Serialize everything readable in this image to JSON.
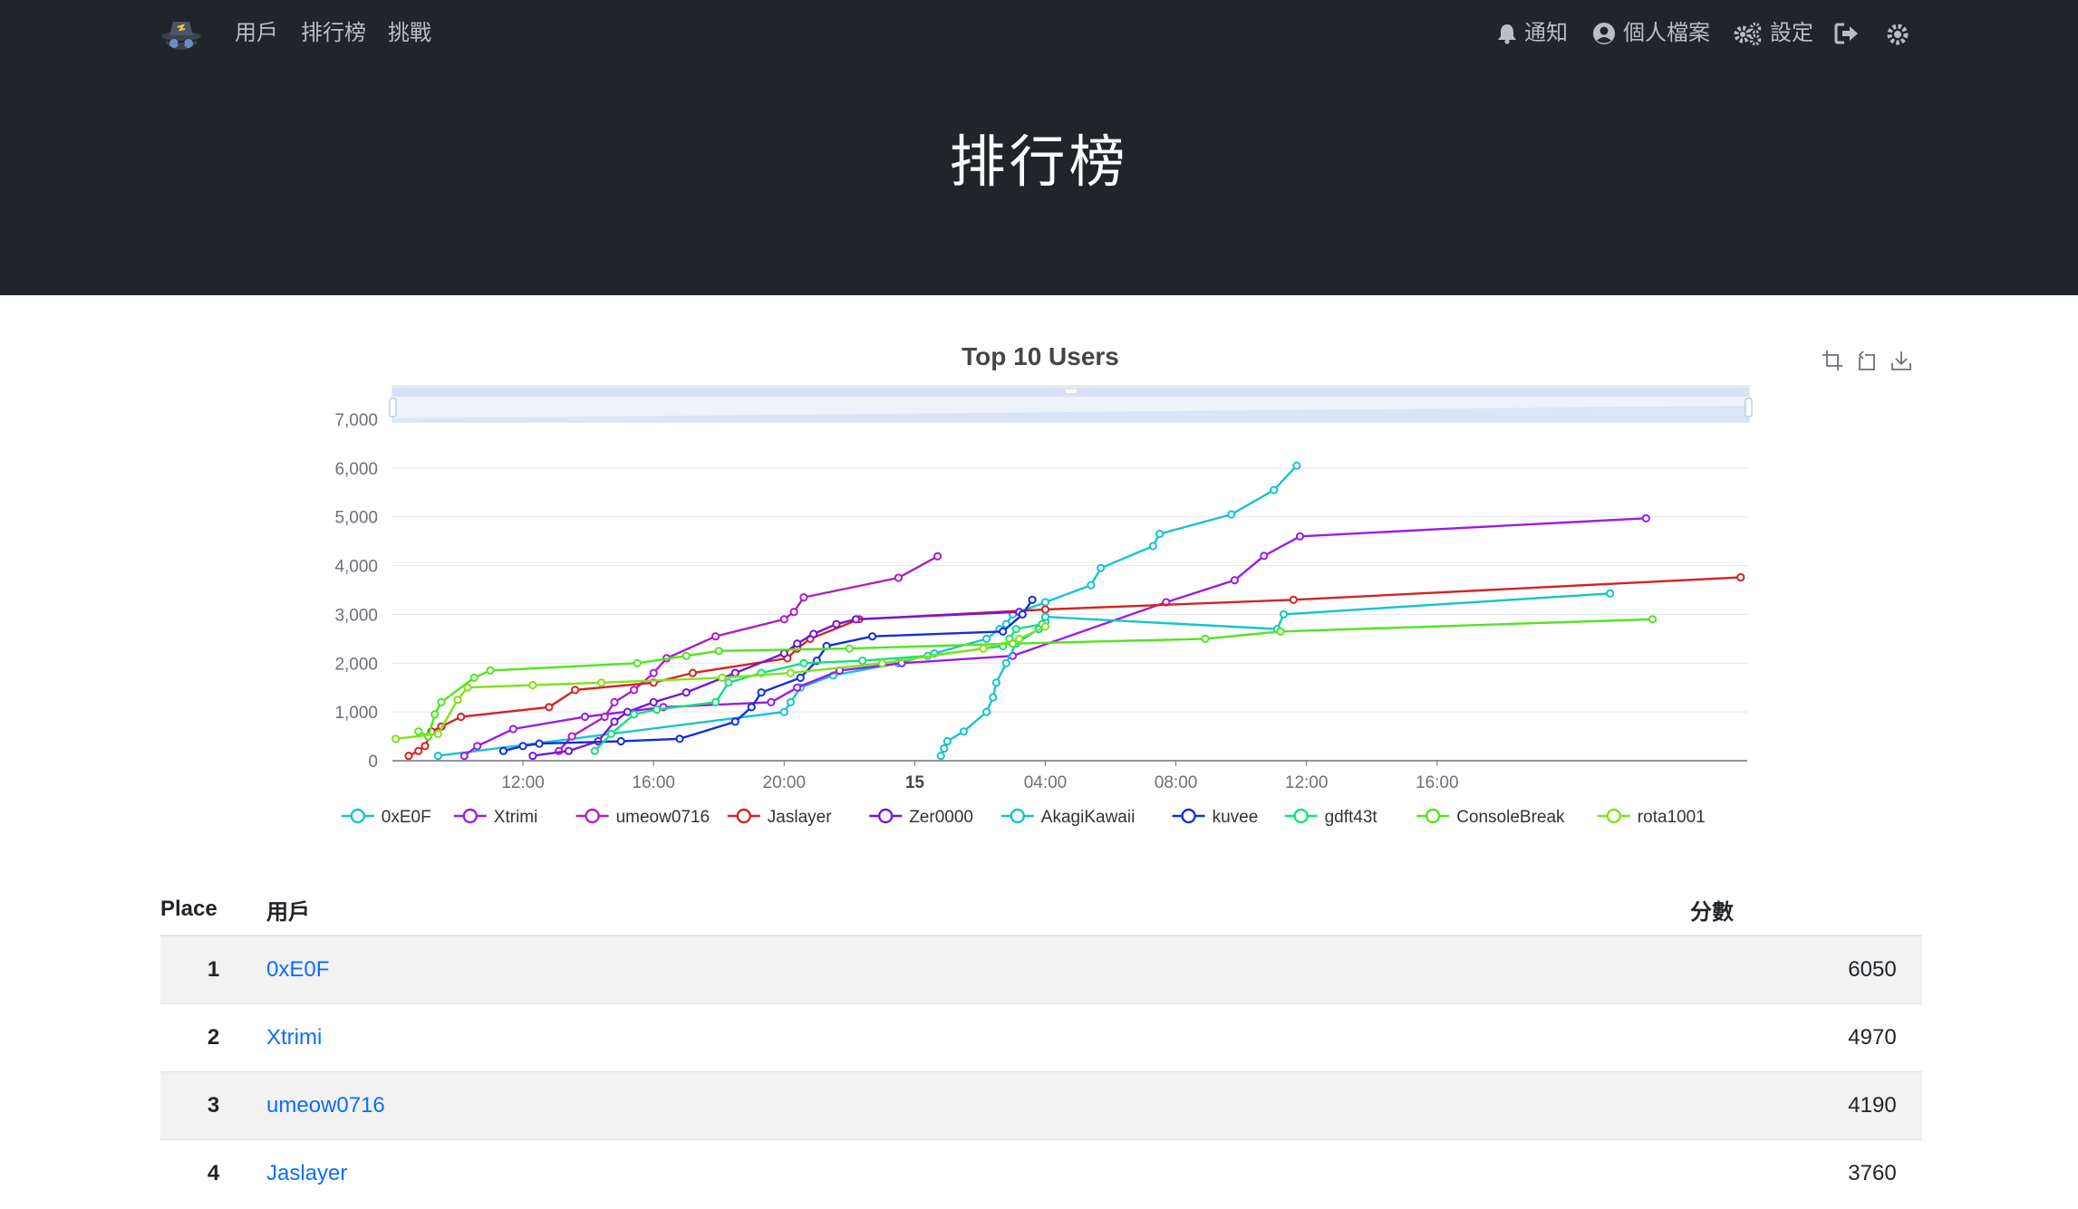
{
  "nav": {
    "links": [
      "用戶",
      "排行榜",
      "挑戰"
    ],
    "notifications_label": "通知",
    "profile_label": "個人檔案",
    "settings_label": "設定"
  },
  "header": {
    "title": "排行榜"
  },
  "chart_data": {
    "type": "line",
    "title": "Top 10 Users",
    "xlabel": "",
    "ylabel": "",
    "ylim": [
      0,
      7000
    ],
    "yticks": [
      "0",
      "1,000",
      "2,000",
      "3,000",
      "4,000",
      "5,000",
      "6,000",
      "7,000"
    ],
    "xlim_hours": [
      6.0,
      47.5
    ],
    "xticks": [
      {
        "label": "12:00",
        "h": 10
      },
      {
        "label": "16:00",
        "h": 14
      },
      {
        "label": "20:00",
        "h": 18
      },
      {
        "label": "15",
        "h": 22,
        "bold": true
      },
      {
        "label": "04:00",
        "h": 26
      },
      {
        "label": "08:00",
        "h": 30
      },
      {
        "label": "12:00",
        "h": 34
      },
      {
        "label": "16:00",
        "h": 38
      }
    ],
    "legend_position": "bottom",
    "grid": true,
    "datazoom_slider": true,
    "series": [
      {
        "name": "0xE0F",
        "color": "#17c3d4",
        "points": [
          [
            7.4,
            100
          ],
          [
            18.0,
            1000
          ],
          [
            18.2,
            1200
          ],
          [
            18.5,
            1500
          ],
          [
            19.5,
            1750
          ],
          [
            21.5,
            2000
          ],
          [
            22.6,
            2200
          ],
          [
            24.2,
            2500
          ],
          [
            24.6,
            2700
          ],
          [
            24.8,
            2800
          ],
          [
            25.0,
            3000
          ],
          [
            26.0,
            3250
          ],
          [
            27.4,
            3600
          ],
          [
            27.7,
            3950
          ],
          [
            29.3,
            4400
          ],
          [
            29.5,
            4650
          ],
          [
            31.7,
            5050
          ],
          [
            33.0,
            5550
          ],
          [
            33.7,
            6050
          ]
        ]
      },
      {
        "name": "Xtrimi",
        "color": "#9b1de6",
        "points": [
          [
            8.2,
            100
          ],
          [
            8.6,
            300
          ],
          [
            9.7,
            650
          ],
          [
            11.9,
            900
          ],
          [
            14.3,
            1100
          ],
          [
            17.6,
            1200
          ],
          [
            18.4,
            1500
          ],
          [
            19.7,
            1850
          ],
          [
            21.6,
            2000
          ],
          [
            25.0,
            2150
          ],
          [
            29.7,
            3250
          ],
          [
            31.8,
            3700
          ],
          [
            32.7,
            4200
          ],
          [
            33.8,
            4600
          ],
          [
            44.4,
            4970
          ]
        ]
      },
      {
        "name": "umeow0716",
        "color": "#b11ec2",
        "points": [
          [
            11.1,
            200
          ],
          [
            11.5,
            500
          ],
          [
            12.5,
            900
          ],
          [
            12.8,
            1200
          ],
          [
            13.4,
            1450
          ],
          [
            14.0,
            1800
          ],
          [
            14.4,
            2100
          ],
          [
            15.9,
            2550
          ],
          [
            18.0,
            2900
          ],
          [
            18.3,
            3050
          ],
          [
            18.6,
            3350
          ],
          [
            21.5,
            3750
          ],
          [
            22.7,
            4190
          ]
        ]
      },
      {
        "name": "Jaslayer",
        "color": "#d42323",
        "points": [
          [
            6.5,
            100
          ],
          [
            6.8,
            200
          ],
          [
            7.0,
            300
          ],
          [
            7.2,
            600
          ],
          [
            7.5,
            700
          ],
          [
            8.1,
            900
          ],
          [
            10.8,
            1100
          ],
          [
            11.6,
            1450
          ],
          [
            14.0,
            1600
          ],
          [
            15.2,
            1800
          ],
          [
            18.1,
            2100
          ],
          [
            18.4,
            2300
          ],
          [
            18.8,
            2500
          ],
          [
            20.3,
            2900
          ],
          [
            26.0,
            3100
          ],
          [
            33.6,
            3300
          ],
          [
            47.3,
            3760
          ]
        ]
      },
      {
        "name": "Zer0000",
        "color": "#7615d9",
        "points": [
          [
            10.3,
            100
          ],
          [
            11.4,
            200
          ],
          [
            12.3,
            400
          ],
          [
            12.8,
            800
          ],
          [
            13.2,
            1000
          ],
          [
            14.0,
            1200
          ],
          [
            15.0,
            1400
          ],
          [
            16.5,
            1800
          ],
          [
            18.0,
            2200
          ],
          [
            18.4,
            2400
          ],
          [
            18.9,
            2600
          ],
          [
            19.6,
            2800
          ],
          [
            20.2,
            2900
          ],
          [
            25.2,
            3050
          ]
        ]
      },
      {
        "name": "AkagiKawaii",
        "color": "#14c6c8",
        "points": [
          [
            22.8,
            100
          ],
          [
            22.9,
            250
          ],
          [
            23.0,
            400
          ],
          [
            23.5,
            600
          ],
          [
            24.2,
            1000
          ],
          [
            24.4,
            1300
          ],
          [
            24.5,
            1600
          ],
          [
            24.8,
            2000
          ],
          [
            25.1,
            2400
          ],
          [
            25.8,
            2700
          ],
          [
            26.0,
            2850
          ],
          [
            26.0,
            2950
          ],
          [
            33.1,
            2700
          ],
          [
            33.3,
            3000
          ],
          [
            43.3,
            3430
          ]
        ]
      },
      {
        "name": "kuvee",
        "color": "#1330d6",
        "points": [
          [
            9.4,
            200
          ],
          [
            10.0,
            300
          ],
          [
            10.5,
            350
          ],
          [
            13.0,
            400
          ],
          [
            14.8,
            450
          ],
          [
            16.5,
            800
          ],
          [
            17.0,
            1100
          ],
          [
            17.3,
            1400
          ],
          [
            18.5,
            1700
          ],
          [
            19.0,
            2050
          ],
          [
            19.3,
            2350
          ],
          [
            20.7,
            2550
          ],
          [
            24.7,
            2650
          ],
          [
            25.3,
            3000
          ],
          [
            25.6,
            3300
          ]
        ]
      },
      {
        "name": "gdft43t",
        "color": "#13e27c",
        "points": [
          [
            12.2,
            200
          ],
          [
            12.7,
            550
          ],
          [
            13.4,
            950
          ],
          [
            14.1,
            1050
          ],
          [
            15.9,
            1200
          ],
          [
            16.3,
            1600
          ],
          [
            17.3,
            1800
          ],
          [
            18.6,
            2000
          ],
          [
            20.4,
            2050
          ],
          [
            22.4,
            2150
          ],
          [
            24.7,
            2350
          ],
          [
            24.9,
            2500
          ],
          [
            25.1,
            2700
          ],
          [
            25.9,
            2800
          ]
        ]
      },
      {
        "name": "ConsoleBreak",
        "color": "#52e51f",
        "points": [
          [
            6.8,
            600
          ],
          [
            7.1,
            500
          ],
          [
            7.3,
            950
          ],
          [
            7.5,
            1200
          ],
          [
            8.5,
            1700
          ],
          [
            9.0,
            1850
          ],
          [
            13.5,
            2000
          ],
          [
            15.0,
            2150
          ],
          [
            16.0,
            2250
          ],
          [
            20.0,
            2300
          ],
          [
            25.0,
            2400
          ],
          [
            30.9,
            2500
          ],
          [
            33.2,
            2650
          ],
          [
            44.6,
            2900
          ]
        ]
      },
      {
        "name": "rota1001",
        "color": "#80e319",
        "points": [
          [
            6.1,
            450
          ],
          [
            7.4,
            550
          ],
          [
            8.0,
            1250
          ],
          [
            8.3,
            1500
          ],
          [
            10.3,
            1550
          ],
          [
            12.4,
            1600
          ],
          [
            16.1,
            1700
          ],
          [
            18.2,
            1800
          ],
          [
            21.0,
            2000
          ],
          [
            24.1,
            2300
          ],
          [
            25.2,
            2500
          ],
          [
            26.0,
            2750
          ]
        ]
      }
    ]
  },
  "table": {
    "headers": [
      "Place",
      "用戶",
      "分數"
    ],
    "rows": [
      {
        "place": "1",
        "user": "0xE0F",
        "score": "6050"
      },
      {
        "place": "2",
        "user": "Xtrimi",
        "score": "4970"
      },
      {
        "place": "3",
        "user": "umeow0716",
        "score": "4190"
      },
      {
        "place": "4",
        "user": "Jaslayer",
        "score": "3760"
      }
    ]
  },
  "colors": {
    "topbar": "#212529",
    "link": "#0d6efd",
    "nav_text": "#b9bec4"
  },
  "icons": {
    "toolbox": [
      "zoom-area-icon",
      "zoom-reset-icon",
      "save-image-icon"
    ],
    "nav": [
      "bell-icon",
      "user-circle-icon",
      "cogs-icon",
      "sign-out-icon",
      "theme-toggle-icon"
    ]
  }
}
